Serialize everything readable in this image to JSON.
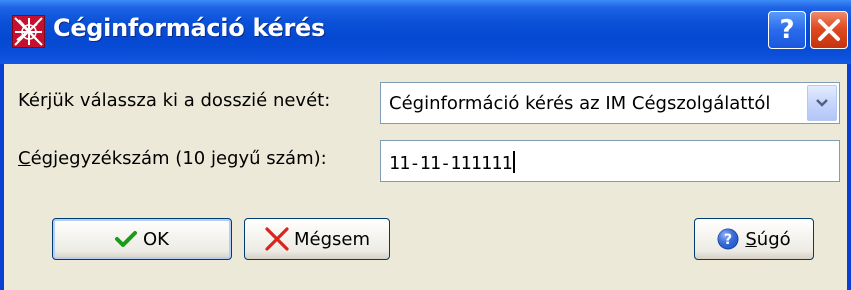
{
  "window": {
    "title": "Céginformáció kérés"
  },
  "titlebar_buttons": {
    "help_glyph": "?"
  },
  "form": {
    "dossier_label": "Kérjük válassza ki a dosszié nevét:",
    "dossier_value": "Céginformáció kérés az IM Cégszolgálattól",
    "regnum_label_underlined": "C",
    "regnum_label_rest": "égjegyzékszám (10 jegyű szám):",
    "regnum_value": "11-11-111111"
  },
  "buttons": {
    "ok_label": "OK",
    "cancel_label": "Mégsem",
    "help_label_underlined": "S",
    "help_label_rest": "úgó"
  },
  "colors": {
    "titlebar": "#0548d1",
    "dialog_bg": "#ece9d8",
    "close_button": "#e04a22",
    "ok_check": "#1a9b1a",
    "cancel_x": "#d8261e",
    "help_icon": "#2a5fd0"
  },
  "icons": {
    "app": "app-icon",
    "help": "help-icon",
    "close": "close-icon",
    "dropdown": "chevron-down-icon",
    "ok": "checkmark-icon",
    "cancel": "x-icon",
    "help_button": "question-circle-icon"
  }
}
